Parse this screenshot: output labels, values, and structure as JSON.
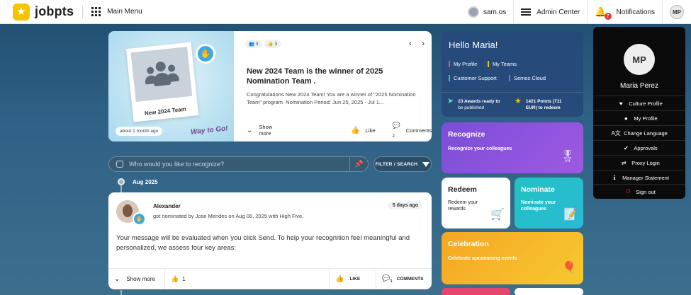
{
  "topbar": {
    "logo_text": "jobpts",
    "main_menu": "Main Menu",
    "user_short": "sam.os",
    "admin_center": "Admin Center",
    "notifications": "Notifications",
    "notifications_count": "7",
    "avatar_initials": "MP"
  },
  "feature": {
    "photo_caption": "New 2024 Team",
    "age": "about 1 month ago",
    "overlay_text": "Way to Go!",
    "chip_people": "3",
    "chip_likes": "3",
    "title": "New 2024 Team is the winner of 2025 Nomination Team .",
    "description": "Congratulations New 2024 Team! You are a winner of \"2025 Nomination Team\" program. Nomination Period: Jun 25, 2025 - Jul 1...",
    "show_more": "Show more",
    "like": "Like",
    "comments": "Comments",
    "comment_count": "2"
  },
  "search": {
    "placeholder": "Who would you like to recognize?",
    "filter_label": "FILTER / SEARCH"
  },
  "timeline": {
    "date": "Aug 2025"
  },
  "post": {
    "name": "Alexander",
    "subtitle": "got nominated by Jose Mendes on Aug 06, 2025 with High Five.",
    "time": "5 days ago",
    "body": "Your message will be evaluated when you click Send. To help your recognition feel meaningful and personalized, we assess four key areas:",
    "show_more": "Show more",
    "like_count": "1",
    "like": "LIKE",
    "comments": "COMMENTS",
    "comment_count": "1"
  },
  "hello": {
    "title": "Hello Maria!",
    "links": [
      {
        "label": "My Profile",
        "color": "#e84a8a"
      },
      {
        "label": "My Teams",
        "color": "#f6c400"
      },
      {
        "label": "Customer Support",
        "color": "#21c2c2"
      },
      {
        "label": "Semos Cloud",
        "color": "#8a63ff"
      }
    ],
    "awards_line1": "23 Awards ready to",
    "awards_line2": "be published",
    "points_line1": "1421 Points (711",
    "points_line2": "EUR) to redeem"
  },
  "tiles": {
    "recognize_title": "Recognize",
    "recognize_sub": "Recognize your colleagues",
    "redeem_title": "Redeem",
    "redeem_sub1": "Redeem your",
    "redeem_sub2": "rewards",
    "nominate_title": "Nominate",
    "nominate_sub1": "Nominate your",
    "nominate_sub2": "colleagues",
    "celebration_title": "Celebration",
    "celebration_sub": "Celebrate upcomming events"
  },
  "profile_menu": {
    "initials": "MP",
    "name": "Maria Perez",
    "items": [
      {
        "label": "Culture Profile",
        "icon": "heart-icon"
      },
      {
        "label": "My Profile",
        "icon": "user-icon"
      },
      {
        "label": "Change Language",
        "icon": "language-icon"
      },
      {
        "label": "Approvals",
        "icon": "check-icon"
      },
      {
        "label": "Proxy Login",
        "icon": "proxy-icon"
      },
      {
        "label": "Manager Statement",
        "icon": "info-icon"
      },
      {
        "label": "Sign out",
        "icon": "power-icon"
      }
    ]
  },
  "colors": {
    "accent_yellow": "#f6c400",
    "purple": "#7b4ed8",
    "teal": "#21c2c2",
    "orange": "#f6a623",
    "sign_out_red": "#e53935"
  }
}
